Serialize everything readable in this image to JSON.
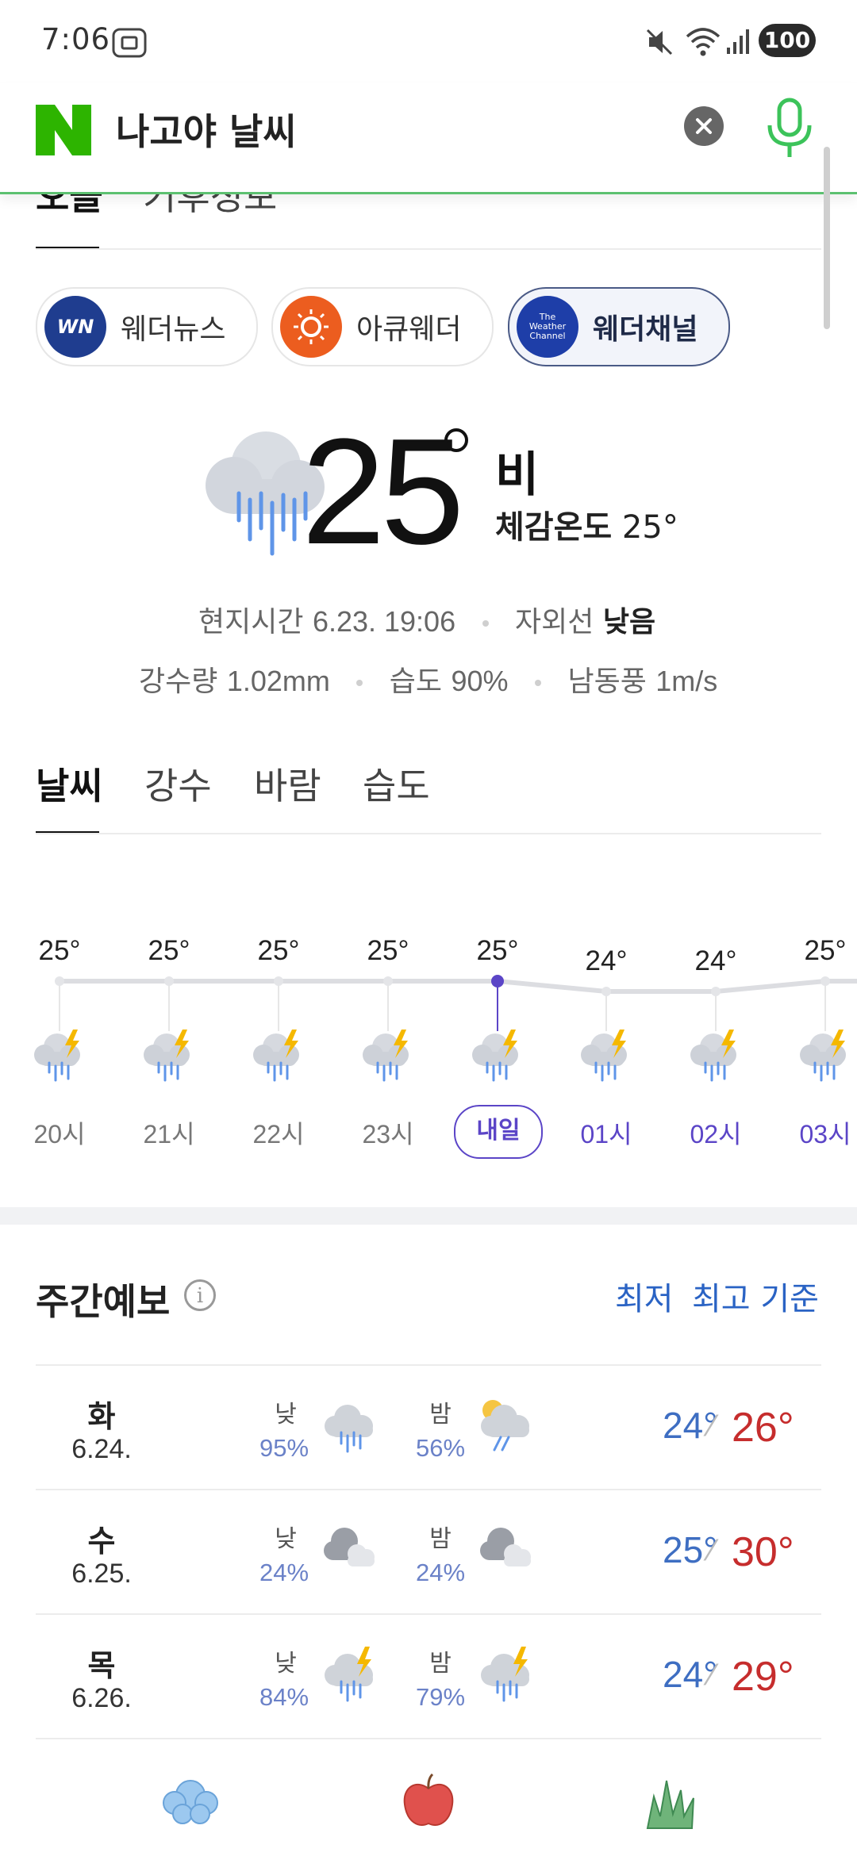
{
  "status_bar": {
    "time": "7:06",
    "battery": "100"
  },
  "search": {
    "query": "나고야 날씨"
  },
  "top_tabs": [
    "오늘",
    "기후정보"
  ],
  "sources": [
    {
      "label": "웨더뉴스",
      "icon": "weathernews-logo",
      "selected": false
    },
    {
      "label": "아큐웨더",
      "icon": "accuweather-logo",
      "selected": false
    },
    {
      "label": "웨더채널",
      "icon": "weather-channel-logo",
      "logo_text": "The Weather Channel",
      "selected": true
    }
  ],
  "current": {
    "temperature": "25",
    "condition": "비",
    "feels_like_label": "체감온도",
    "feels_like": "25°",
    "local_time_label": "현지시간",
    "local_time": "6.23. 19:06",
    "uv_label": "자외선",
    "uv": "낮음",
    "precip_label": "강수량",
    "precip": "1.02mm",
    "humidity_label": "습도",
    "humidity": "90%",
    "wind_label": "남동풍",
    "wind": "1m/s"
  },
  "metric_tabs": [
    "날씨",
    "강수",
    "바람",
    "습도"
  ],
  "hourly": [
    {
      "temp": "25°",
      "value": 25,
      "label": "20시",
      "next_day": false
    },
    {
      "temp": "25°",
      "value": 25,
      "label": "21시",
      "next_day": false
    },
    {
      "temp": "25°",
      "value": 25,
      "label": "22시",
      "next_day": false
    },
    {
      "temp": "25°",
      "value": 25,
      "label": "23시",
      "next_day": false
    },
    {
      "temp": "25°",
      "value": 25,
      "label": "내일",
      "next_day": true,
      "current": true
    },
    {
      "temp": "24°",
      "value": 24,
      "label": "01시",
      "next_day": true
    },
    {
      "temp": "24°",
      "value": 24,
      "label": "02시",
      "next_day": true
    },
    {
      "temp": "25°",
      "value": 25,
      "label": "03시",
      "next_day": true
    }
  ],
  "weekly": {
    "title": "주간예보",
    "sort_low": "최저",
    "sort_high": "최고 기준",
    "day_label": "낮",
    "night_label": "밤",
    "days": [
      {
        "day": "화",
        "date": "6.24.",
        "day_pct": "95%",
        "night_pct": "56%",
        "day_icon": "rain-cloud-icon",
        "night_icon": "moon-rain-cloud-icon",
        "low": "24°",
        "high": "26°"
      },
      {
        "day": "수",
        "date": "6.25.",
        "day_pct": "24%",
        "night_pct": "24%",
        "day_icon": "cloudy-icon",
        "night_icon": "cloudy-icon",
        "low": "25°",
        "high": "30°"
      },
      {
        "day": "목",
        "date": "6.26.",
        "day_pct": "84%",
        "night_pct": "79%",
        "day_icon": "thunderstorm-icon",
        "night_icon": "thunderstorm-icon",
        "low": "24°",
        "high": "29°"
      }
    ]
  },
  "bottom_nav": [
    "cloud-icon",
    "apple-icon",
    "grass-icon"
  ],
  "colors": {
    "naver_green": "#2db400",
    "accent_purple": "#5b45c7",
    "high_red": "#c62d2d",
    "low_blue": "#3e6ec2"
  }
}
